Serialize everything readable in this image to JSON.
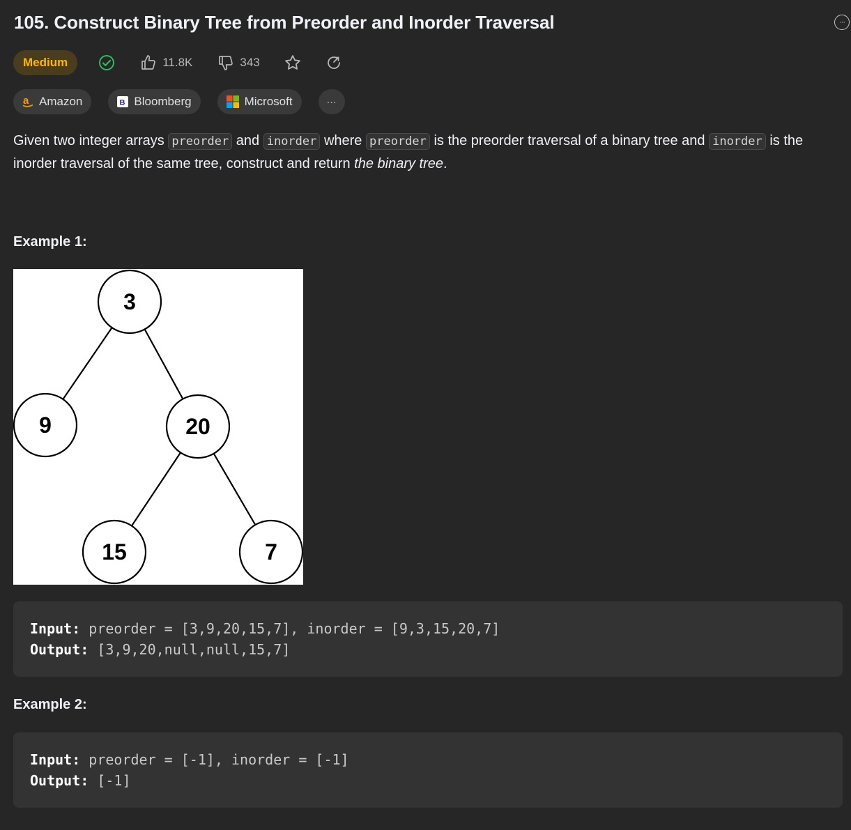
{
  "problem": {
    "title": "105. Construct Binary Tree from Preorder and Inorder Traversal",
    "difficulty": "Medium",
    "likes": "11.8K",
    "dislikes": "343"
  },
  "companies": [
    {
      "name": "Amazon"
    },
    {
      "name": "Bloomberg"
    },
    {
      "name": "Microsoft"
    }
  ],
  "more_companies_label": "···",
  "description": {
    "p1": "Given two integer arrays",
    "code_preorder": "preorder",
    "and": "and",
    "code_inorder": "inorder",
    "where": "where",
    "is_pre": "is the preorder traversal of a binary tree and",
    "is_in": "is the inorder traversal of the same tree, construct and return",
    "em": "the binary tree",
    "end": "."
  },
  "examples": [
    {
      "title": "Example 1:",
      "input_label": "Input:",
      "input": "preorder = [3,9,20,15,7], inorder = [9,3,15,20,7]",
      "output_label": "Output:",
      "output": "[3,9,20,null,null,15,7]"
    },
    {
      "title": "Example 2:",
      "input_label": "Input:",
      "input": "preorder = [-1], inorder = [-1]",
      "output_label": "Output:",
      "output": "[-1]"
    }
  ],
  "tree": {
    "nodes": [
      "3",
      "9",
      "20",
      "15",
      "7"
    ]
  },
  "colors": {
    "background": "#262626",
    "difficulty_medium": "#ffb800",
    "solved_check": "#2cbb5d",
    "code_block": "#333333"
  },
  "icons": {
    "more": "ellipsis-circle-icon",
    "solved": "check-circle-icon",
    "like": "thumbs-up-icon",
    "dislike": "thumbs-down-icon",
    "favorite": "star-icon",
    "share": "share-icon"
  }
}
